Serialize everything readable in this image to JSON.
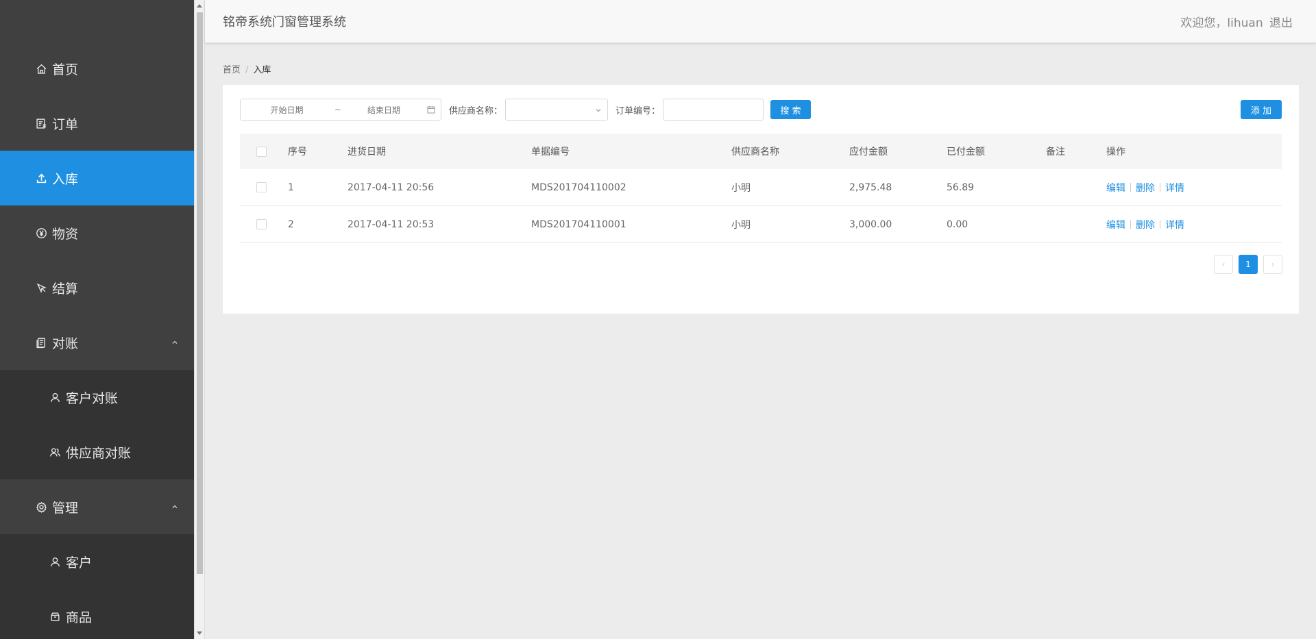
{
  "sidebar": {
    "items": [
      {
        "label": "首页",
        "icon": "home-icon"
      },
      {
        "label": "订单",
        "icon": "order-icon"
      },
      {
        "label": "入库",
        "icon": "upload-icon",
        "active": true
      },
      {
        "label": "物资",
        "icon": "yen-icon"
      },
      {
        "label": "结算",
        "icon": "cursor-icon"
      },
      {
        "label": "对账",
        "icon": "document-icon",
        "expanded": true
      },
      {
        "label": "客户对账",
        "icon": "user-icon",
        "sub": true
      },
      {
        "label": "供应商对账",
        "icon": "users-icon",
        "sub": true
      },
      {
        "label": "管理",
        "icon": "gear-icon",
        "expanded": true
      },
      {
        "label": "客户",
        "icon": "user-icon",
        "sub": true
      },
      {
        "label": "商品",
        "icon": "box-icon",
        "sub": true
      }
    ]
  },
  "header": {
    "title": "铭帝系统门窗管理系统",
    "welcome": "欢迎您，lihuan",
    "logout": "退出"
  },
  "breadcrumb": {
    "home": "首页",
    "separator": "/",
    "current": "入库"
  },
  "toolbar": {
    "start_date_placeholder": "开始日期",
    "range_separator": "~",
    "end_date_placeholder": "结束日期",
    "supplier_label": "供应商名称：",
    "supplier_value": "",
    "order_no_label": "订单编号：",
    "order_no_value": "",
    "search_label": "搜 索",
    "add_label": "添 加"
  },
  "table": {
    "columns": [
      "序号",
      "进货日期",
      "单据编号",
      "供应商名称",
      "应付金额",
      "已付金额",
      "备注",
      "操作"
    ],
    "rows": [
      {
        "no": "1",
        "date": "2017-04-11 20:56",
        "code": "MDS201704110002",
        "supplier": "小明",
        "payable": "2,975.48",
        "paid": "56.89",
        "note": ""
      },
      {
        "no": "2",
        "date": "2017-04-11 20:53",
        "code": "MDS201704110001",
        "supplier": "小明",
        "payable": "3,000.00",
        "paid": "0.00",
        "note": ""
      }
    ],
    "ops": {
      "edit": "编辑",
      "delete": "删除",
      "detail": "详情"
    }
  },
  "pagination": {
    "prev": "‹",
    "current": "1",
    "next": "›"
  },
  "colors": {
    "accent": "#1e8fe1",
    "sidebar_bg": "#404040",
    "submenu_bg": "#333333"
  }
}
